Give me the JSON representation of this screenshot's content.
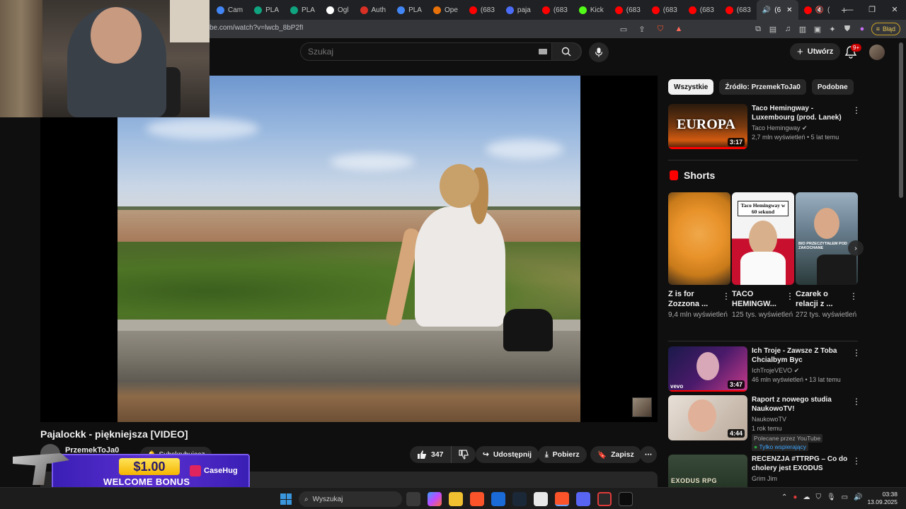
{
  "browser": {
    "tabs": [
      {
        "label": "Cam",
        "color": "#4285f4"
      },
      {
        "label": "PLA",
        "color": "#10a37f"
      },
      {
        "label": "PLA",
        "color": "#10a37f"
      },
      {
        "label": "Ogl",
        "color": "#ffffff"
      },
      {
        "label": "Auth",
        "color": "#d93025"
      },
      {
        "label": "PLA",
        "color": "#4285f4"
      },
      {
        "label": "Ope",
        "color": "#e8710a"
      },
      {
        "label": "(683",
        "color": "#ff0000"
      },
      {
        "label": "paja",
        "color": "#4a6cf7"
      },
      {
        "label": "(683",
        "color": "#ff0000"
      },
      {
        "label": "Kick",
        "color": "#53fc18"
      },
      {
        "label": "(683",
        "color": "#ff0000"
      },
      {
        "label": "(683",
        "color": "#ff0000"
      },
      {
        "label": "(683",
        "color": "#ff0000"
      },
      {
        "label": "(683",
        "color": "#ff0000"
      }
    ],
    "active_tab": "(6",
    "last_tab": "(",
    "url": "be.com/watch?v=lwcb_8bP2fI",
    "error_label": "Błąd"
  },
  "header": {
    "search_placeholder": "Szukaj",
    "create_label": "Utwórz",
    "notif_count": "9+"
  },
  "video": {
    "title": "Pajalockk - piękniejsza [VIDEO]",
    "channel": "PrzemekToJa0",
    "subscribe_label": "Subskrybujesz",
    "likes": "347",
    "share_label": "Udostępnij",
    "download_label": "Pobierz",
    "save_label": "Zapisz"
  },
  "promo": {
    "amount": "$1.00",
    "text": "WELCOME BONUS",
    "brand": "CaseHug"
  },
  "sidebar": {
    "chips": [
      "Wszystkie",
      "Źródło: PrzemekToJa0",
      "Podobne"
    ],
    "recs": [
      {
        "title": "Taco Hemingway - Luxembourg (prod. Lanek)",
        "channel": "Taco Hemingway",
        "meta": "2,7 mln wyświetleń • 5 lat temu",
        "duration": "3:17",
        "thumb_text": "EUROPA"
      },
      {
        "title": "Ich Troje - Zawsze Z Toba Chcialbym Byc",
        "channel": "IchTrojeVEVO",
        "meta": "46 mln wyświetleń • 13 lat temu",
        "duration": "3:47",
        "thumb_text": "vevo"
      },
      {
        "title": "Raport z nowego studia NaukowoTV!",
        "channel": "NaukowoTV",
        "meta": "1 rok temu",
        "duration": "4:44",
        "tag1": "Polecane przez YouTube",
        "tag2": "Tylko wspierający"
      },
      {
        "title": "RECENZJA #TTRPG – Co do cholery jest EXODUS",
        "channel": "Grim Jim",
        "thumb_text": "EXODUS RPG"
      }
    ],
    "shorts_title": "Shorts",
    "shorts": [
      {
        "title": "Z is for Zozzona ...",
        "views": "9,4 mln wyświetleń"
      },
      {
        "title": "TACO HEMINGW...",
        "views": "125 tys. wyświetleń",
        "thumb_text": "Taco Hemingway w 60 sekund"
      },
      {
        "title": "Czarek o relacji z ...",
        "views": "272 tys. wyświetleń",
        "thumb_text": "BIO PRZECZYTAŁEM POD ZAKOCHANE"
      }
    ]
  },
  "taskbar": {
    "search_label": "Wyszukaj",
    "time": "03:38",
    "date": "13.09.2025"
  }
}
